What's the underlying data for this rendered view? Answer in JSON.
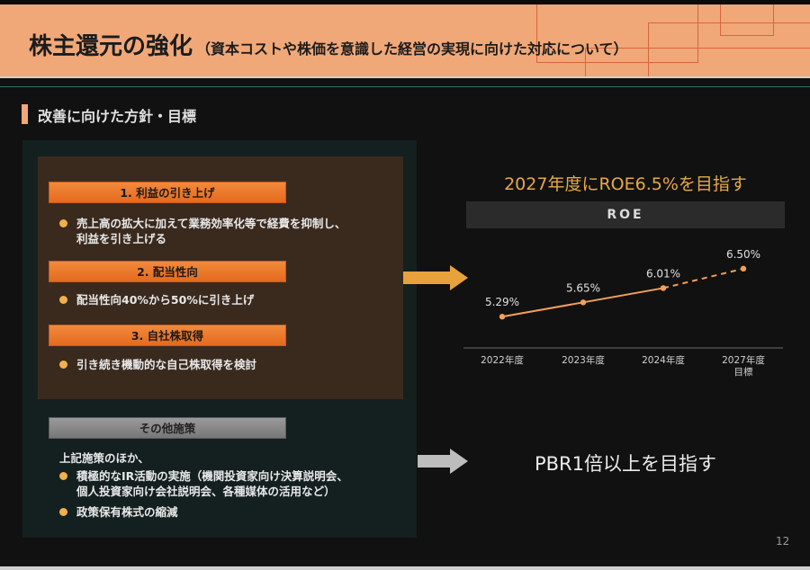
{
  "header": {
    "title": "株主還元の強化",
    "subtitle": "（資本コストや株価を意識した経営の実現に向けた対応について）"
  },
  "section": {
    "title": "改善に向けた方針・目標"
  },
  "policies": [
    {
      "label": "1. 利益の引き上げ",
      "bullets": [
        [
          "売上高の拡大に加えて業務効率化等で経費を抑制し、",
          "利益を引き上げる"
        ]
      ]
    },
    {
      "label": "2. 配当性向",
      "bullets": [
        [
          "配当性向40%から50%に引き上げ"
        ]
      ]
    },
    {
      "label": "3. 自社株取得",
      "bullets": [
        [
          "引き続き機動的な自己株取得を検討"
        ]
      ]
    }
  ],
  "other": {
    "label": "その他施策",
    "intro": "上記施策のほか、",
    "bullets": [
      [
        "積極的なIR活動の実施（機関投資家向け決算説明会、",
        "個人投資家向け会社説明会、各種媒体の活用など）"
      ],
      [
        "政策保有株式の縮減"
      ]
    ]
  },
  "goal_roe": "2027年度にROE6.5%を目指す",
  "roe_label": "ROE",
  "goal_pbr": "PBR1倍以上を目指す",
  "page_number": "12",
  "colors": {
    "accent": "#f0a878",
    "orange": "#e8782a",
    "gold": "#e6a94a",
    "line": "#f2a05a"
  },
  "chart_data": {
    "type": "line",
    "categories": [
      [
        "2022年度"
      ],
      [
        "2023年度"
      ],
      [
        "2024年度"
      ],
      [
        "2027年度",
        "目標"
      ]
    ],
    "values": [
      5.29,
      5.65,
      6.01,
      6.5
    ],
    "data_labels": [
      "5.29%",
      "5.65%",
      "6.01%",
      "6.50%"
    ],
    "dashed_last_segment": true,
    "unit": "%",
    "grid": false
  }
}
